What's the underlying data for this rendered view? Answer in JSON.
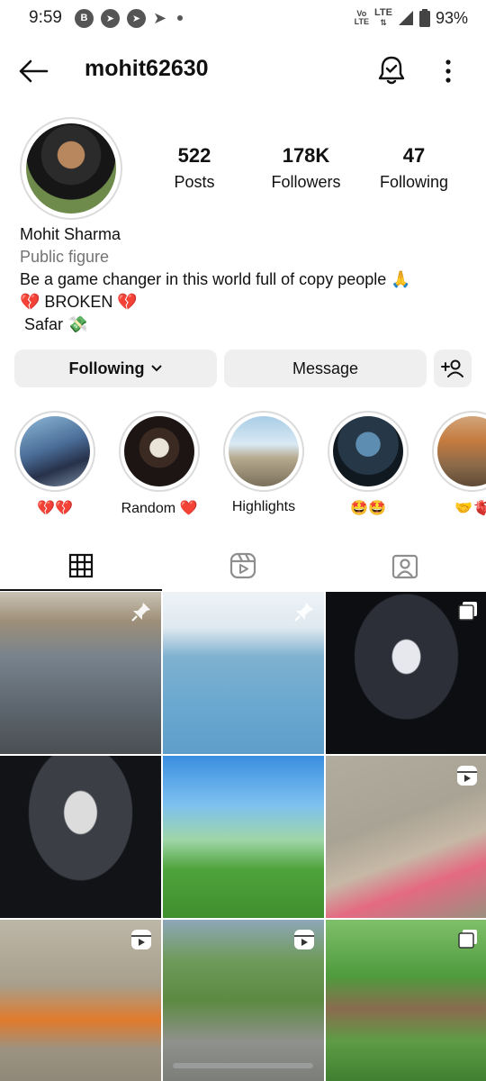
{
  "status_bar": {
    "time": "9:59",
    "notif_b": "B",
    "volte_top": "Vo",
    "volte_bottom": "LTE",
    "lte": "LTE",
    "battery": "93%"
  },
  "header": {
    "username": "mohit62630",
    "icons": [
      "back-arrow-icon",
      "bell-check-icon",
      "more-vertical-icon"
    ]
  },
  "profile": {
    "stats": {
      "posts_count": "522",
      "posts_label": "Posts",
      "followers_count": "178K",
      "followers_label": "Followers",
      "following_count": "47",
      "following_label": "Following"
    },
    "name": "Mohit Sharma",
    "category": "Public figure",
    "bio_lines": [
      "Be a game changer in this world full of copy people 🙏",
      "💔 BROKEN 💔",
      " Safar 💸"
    ]
  },
  "actions": {
    "following_label": "Following",
    "message_label": "Message"
  },
  "highlights": [
    {
      "label": "💔💔"
    },
    {
      "label": "Random ❤️"
    },
    {
      "label": "Highlights"
    },
    {
      "label": "🤩🤩"
    },
    {
      "label": "🤝🫀"
    }
  ],
  "tabs": [
    "grid-icon",
    "reels-icon",
    "tagged-icon"
  ],
  "colors": {
    "button_bg": "#efefef",
    "secondary_text": "#737373",
    "divider": "#dbdbdb"
  }
}
